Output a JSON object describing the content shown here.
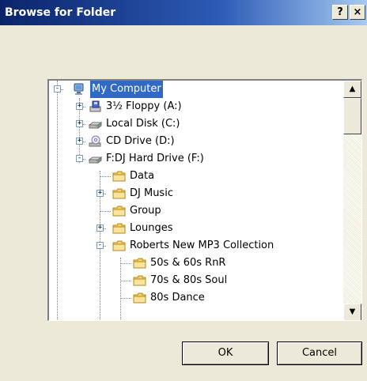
{
  "window": {
    "title": "Browse for Folder",
    "help_label": "?",
    "close_label": "×"
  },
  "tree": {
    "items": [
      {
        "label": "My Computer",
        "icon": "computer-icon",
        "expander": "-",
        "selected": true
      },
      {
        "label": "3½ Floppy (A:)",
        "icon": "floppy-drive-icon",
        "expander": "+"
      },
      {
        "label": "Local Disk (C:)",
        "icon": "hard-drive-icon",
        "expander": "+"
      },
      {
        "label": "CD Drive (D:)",
        "icon": "cd-drive-icon",
        "expander": "+"
      },
      {
        "label": "F:DJ Hard Drive (F:)",
        "icon": "hard-drive-icon",
        "expander": "-"
      },
      {
        "label": "Data",
        "icon": "folder-icon",
        "expander": ""
      },
      {
        "label": "DJ Music",
        "icon": "folder-icon",
        "expander": "+"
      },
      {
        "label": "Group",
        "icon": "folder-icon",
        "expander": ""
      },
      {
        "label": "Lounges",
        "icon": "folder-icon",
        "expander": "+"
      },
      {
        "label": "Roberts New MP3 Collection",
        "icon": "folder-icon",
        "expander": "-"
      },
      {
        "label": "50s & 60s RnR",
        "icon": "folder-icon",
        "expander": ""
      },
      {
        "label": "70s & 80s Soul",
        "icon": "folder-icon",
        "expander": ""
      },
      {
        "label": "80s Dance",
        "icon": "folder-icon",
        "expander": ""
      }
    ]
  },
  "scrollbar": {
    "up_arrow": "▲",
    "down_arrow": "▼"
  },
  "buttons": {
    "ok_label": "OK",
    "cancel_label": "Cancel"
  },
  "colors": {
    "selection": "#316ac5",
    "titlebar": "#0a246a",
    "dialog": "#ece9d8"
  }
}
